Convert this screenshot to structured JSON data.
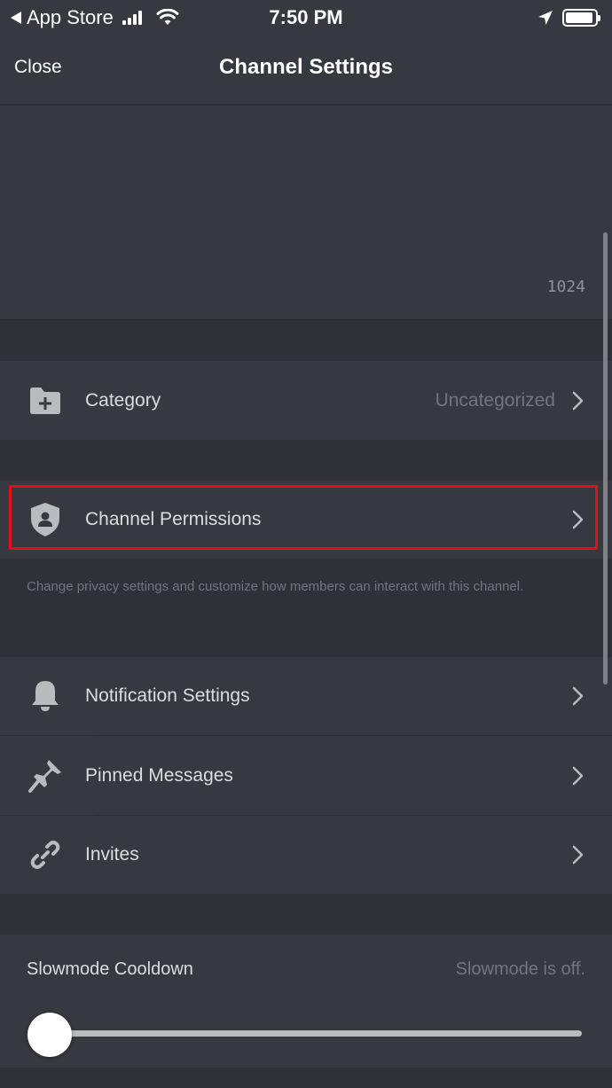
{
  "status_bar": {
    "back_app": "App Store",
    "time": "7:50 PM",
    "battery_level": 0.95
  },
  "nav": {
    "close_label": "Close",
    "title": "Channel Settings"
  },
  "topic": {
    "char_count": "1024"
  },
  "category": {
    "label": "Category",
    "value": "Uncategorized"
  },
  "permissions": {
    "label": "Channel Permissions",
    "helper": "Change privacy settings and customize how members can interact with this channel."
  },
  "menu_items": [
    {
      "label": "Notification Settings",
      "icon": "bell-icon"
    },
    {
      "label": "Pinned Messages",
      "icon": "pin-icon"
    },
    {
      "label": "Invites",
      "icon": "link-icon"
    }
  ],
  "slowmode": {
    "label": "Slowmode Cooldown",
    "value": "Slowmode is off.",
    "slider_level": 0
  },
  "colors": {
    "background": "#2f3136",
    "row": "#36393f",
    "highlight": "#e1101b",
    "muted_text": "#72767d"
  }
}
